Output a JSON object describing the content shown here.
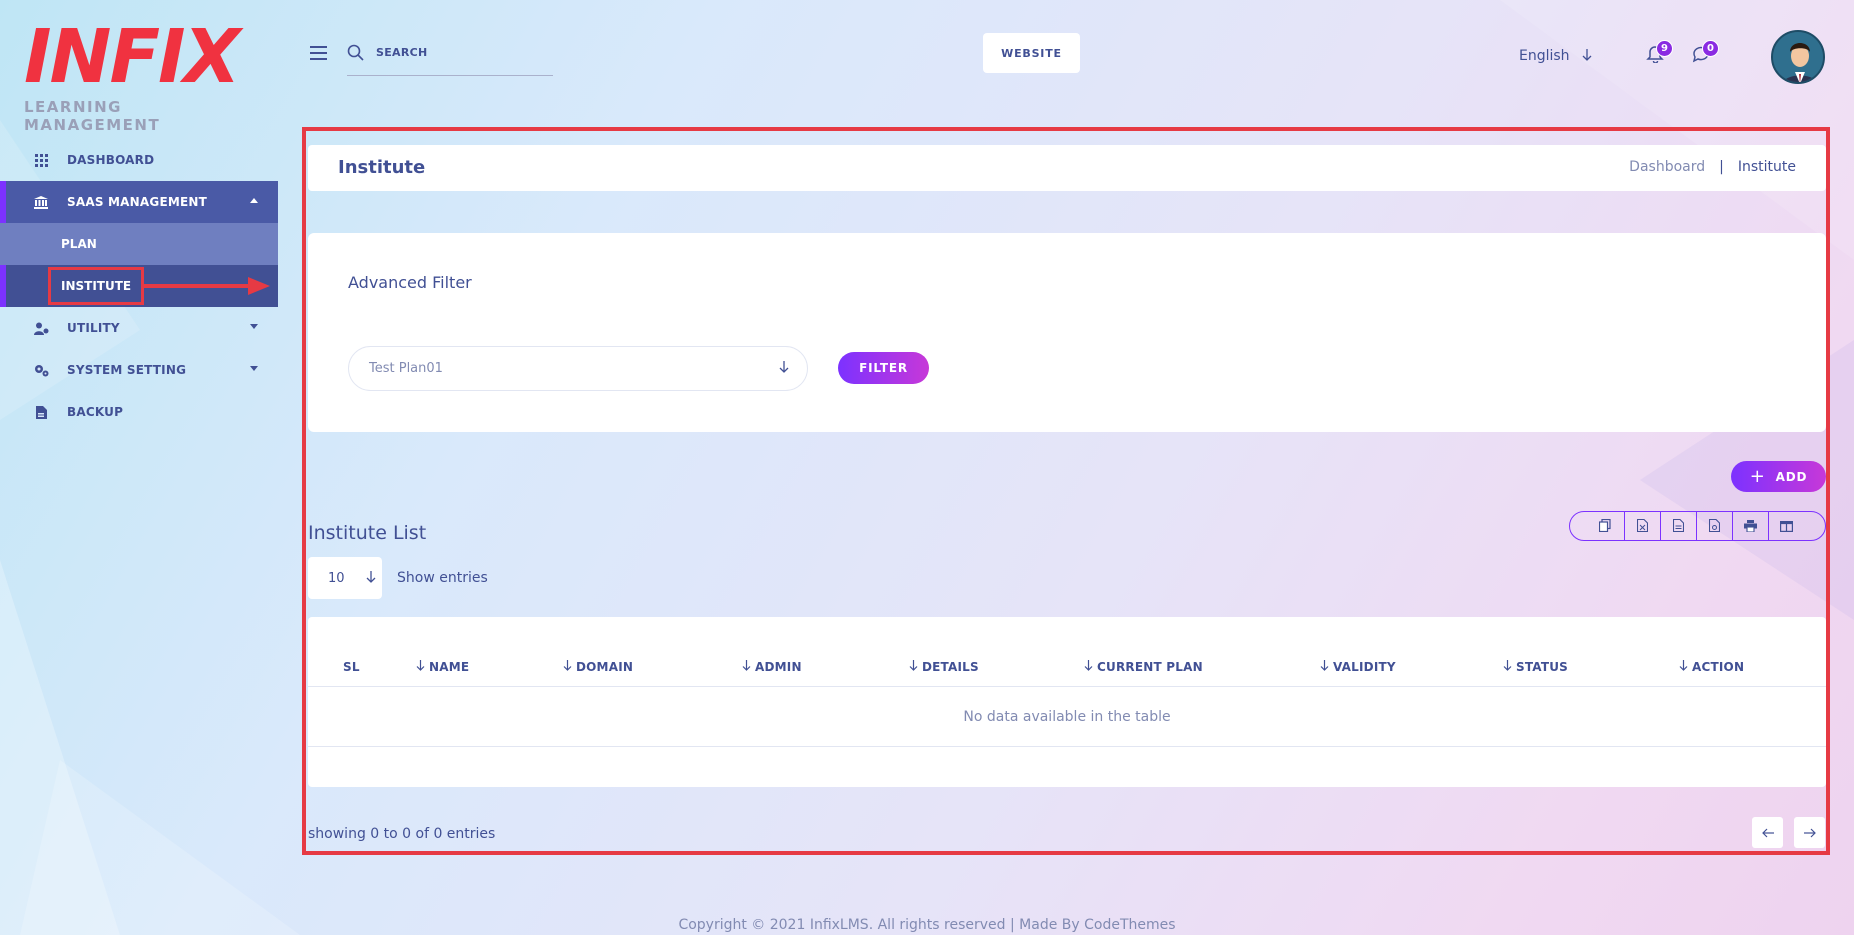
{
  "logo": {
    "main": "INFIX",
    "sub": "LEARNING MANAGEMENT"
  },
  "sidebar": {
    "items": [
      {
        "label": "DASHBOARD",
        "icon": "grid-icon"
      },
      {
        "label": "SAAS MANAGEMENT",
        "icon": "bank-icon"
      },
      {
        "label": "UTILITY",
        "icon": "user-gear-icon"
      },
      {
        "label": "SYSTEM SETTING",
        "icon": "gears-icon"
      },
      {
        "label": "BACKUP",
        "icon": "file-icon"
      }
    ],
    "sub_items": [
      {
        "label": "PLAN"
      },
      {
        "label": "INSTITUTE"
      }
    ]
  },
  "header": {
    "search_placeholder": "SEARCH",
    "website_label": "WEBSITE",
    "language": "English",
    "notifications_count": "9",
    "messages_count": "0"
  },
  "page": {
    "title": "Institute",
    "breadcrumb": [
      "Dashboard",
      "|",
      "Institute"
    ]
  },
  "filter": {
    "title": "Advanced Filter",
    "selected_plan": "Test Plan01",
    "button_label": "FILTER"
  },
  "list": {
    "add_label": "ADD",
    "title": "Institute List",
    "entries_value": "10",
    "entries_label": "Show entries",
    "columns": [
      "SL",
      "NAME",
      "DOMAIN",
      "ADMIN",
      "DETAILS",
      "CURRENT PLAN",
      "VALIDITY",
      "STATUS",
      "ACTION"
    ],
    "empty_text": "No data available in the table",
    "showing": "showing 0 to 0 of 0 entries",
    "tools": [
      "copy-icon",
      "excel-icon",
      "csv-icon",
      "pdf-icon",
      "print-icon",
      "columns-icon"
    ]
  },
  "footer": {
    "text": "Copyright © 2021 InfixLMS. All rights reserved | Made By CodeThemes"
  },
  "colors": {
    "primary": "#415094",
    "accent": "#7c32ff",
    "highlight": "#e63a44"
  }
}
